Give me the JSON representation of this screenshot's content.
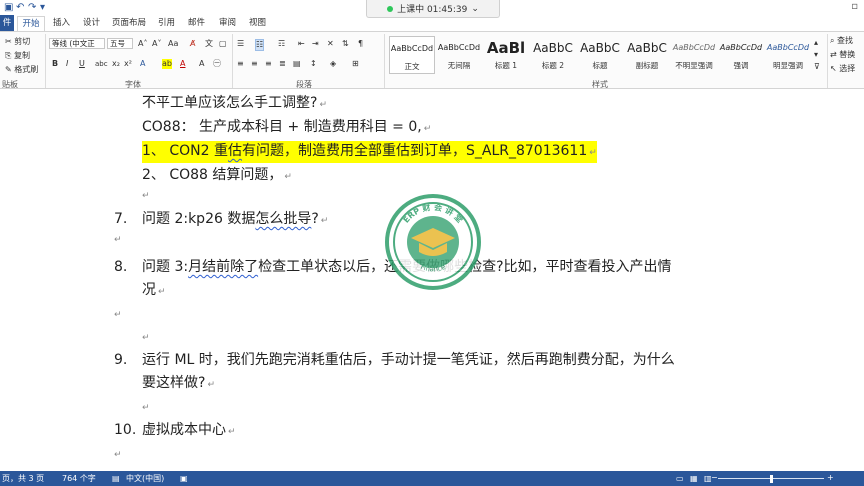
{
  "titlebar": {
    "recording_label": "上课中 01:45:39"
  },
  "tabs": {
    "file": "件",
    "home": "开始",
    "insert": "插入",
    "design": "设计",
    "layout": "页面布局",
    "references": "引用",
    "mailings": "邮件",
    "review": "审阅",
    "view": "视图"
  },
  "ribbon": {
    "clipboard": {
      "cut": "剪切",
      "copy": "复制",
      "format_painter": "格式刷",
      "label": "贴板"
    },
    "font": {
      "font_name": "等线 (中文正",
      "font_size": "五号",
      "label": "字体"
    },
    "paragraph": {
      "label": "段落"
    },
    "styles": {
      "label": "样式",
      "items": [
        {
          "preview": "AaBbCcDd",
          "name": "正文"
        },
        {
          "preview": "AaBbCcDd",
          "name": "无间隔"
        },
        {
          "preview": "AaBl",
          "name": "标题 1"
        },
        {
          "preview": "AaBbC",
          "name": "标题 2"
        },
        {
          "preview": "AaBbC",
          "name": "标题"
        },
        {
          "preview": "AaBbC",
          "name": "副标题"
        },
        {
          "preview": "AaBbCcDd",
          "name": "不明显强调"
        },
        {
          "preview": "AaBbCcDd",
          "name": "强调"
        },
        {
          "preview": "AaBbCcDd",
          "name": "明显强调"
        }
      ]
    },
    "editing": {
      "find": "查找",
      "replace": "替换",
      "select": "选择"
    }
  },
  "document": {
    "l1": "不平工单应该怎么手工调整?",
    "l2": "CO88：  生产成本科目  +  制造费用科目  = 0,",
    "l3a": "1、 CON2 重",
    "l3b": "估",
    "l3c": "有问题，制造费用全部重估到订单，S_ALR_87013611",
    "l4": "2、 CO88 结算问题，",
    "n7": "7.",
    "l7a": "问题 2:kp26 数据",
    "l7b": "怎么批导",
    "l7c": "?",
    "n8": "8.",
    "l8a": "问题  3:",
    "l8b": "月结前除了",
    "l8c": "检查工单状态以后，还需要做哪些检查?比如，平时查看投入产出情",
    "l8d": "况",
    "n9": "9.",
    "l9a": "运行 ML 时，我们先跑完消耗重估后，手动计提一笔凭证，然后再跑制费分配，为什么",
    "l9b": "要这样做?",
    "n10": "10.",
    "l10": "虚拟成本中心"
  },
  "watermark": {
    "top_text": "ERP 财 会 讲 堂",
    "bottom_text": "Finance"
  },
  "statusbar": {
    "page": "页，共 3 页",
    "words": "764 个字",
    "language": "中文(中国)"
  },
  "colors": {
    "accent": "#2b579a",
    "highlight": "#ffff00",
    "watermark_green": "#2e9e6b",
    "watermark_gold": "#e8b832"
  }
}
